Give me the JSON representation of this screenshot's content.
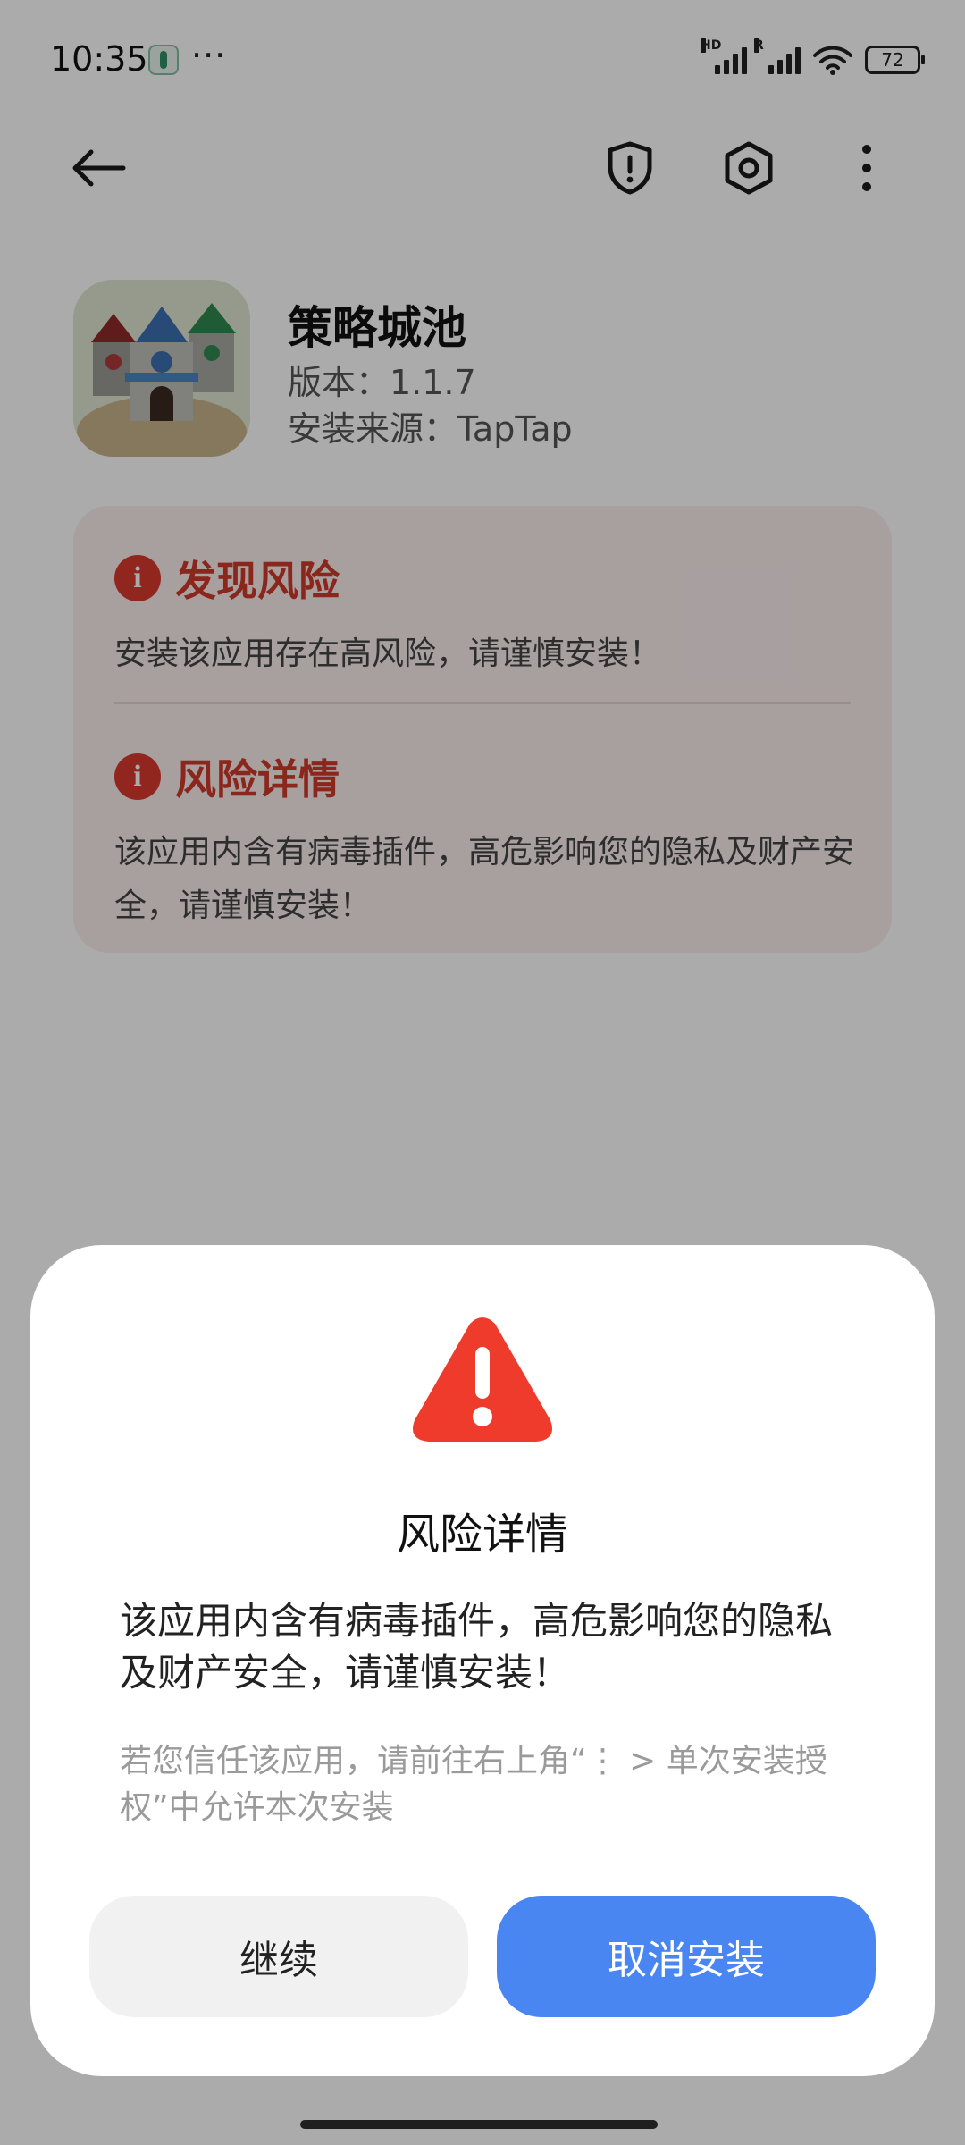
{
  "status_bar": {
    "time": "10:35",
    "more": "···",
    "signal_tags": [
      "HD",
      "R"
    ],
    "battery": "72"
  },
  "app": {
    "name": "策略城池",
    "version": "版本：1.1.7",
    "source": "安装来源：TapTap"
  },
  "risk_card": {
    "section1": {
      "title": "发现风险",
      "text": "安装该应用存在高风险，请谨慎安装！"
    },
    "section2": {
      "title": "风险详情",
      "text": "该应用内含有病毒插件，高危影响您的隐私及财产安全，请谨慎安装！"
    },
    "icon_glyph": "i"
  },
  "dialog": {
    "title": "风险详情",
    "body": "该应用内含有病毒插件，高危影响您的隐私及财产安全，请谨慎安装！",
    "hint": "若您信任该应用，请前往右上角“⋮ > 单次安装授权”中允许本次安装",
    "continue_label": "继续",
    "cancel_label": "取消安装"
  },
  "colors": {
    "danger": "#d93a2f",
    "primary_button": "#4a86f2",
    "secondary_button": "#f1f1f1"
  },
  "icons": {
    "back": "arrow-left-icon",
    "security": "shield-exclamation-icon",
    "settings": "hexagon-settings-icon",
    "more": "vertical-dots-icon",
    "warning": "warning-triangle-icon"
  }
}
